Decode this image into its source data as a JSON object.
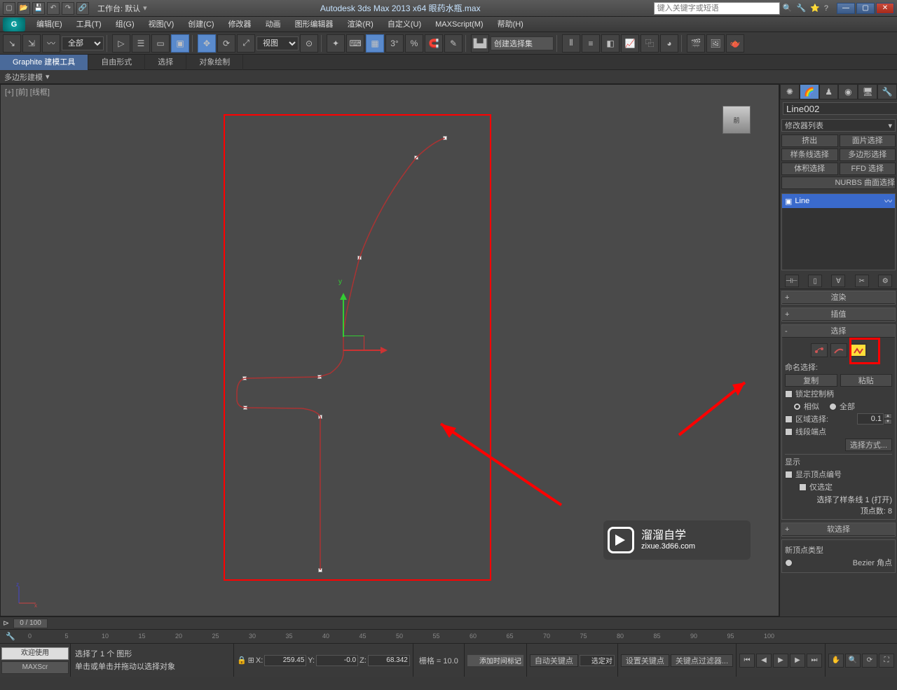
{
  "title": "Autodesk 3ds Max  2013 x64   眼药水瓶.max",
  "workspace_label": "工作台: 默认",
  "search_placeholder": "键入关键字或短语",
  "menus": [
    "编辑(E)",
    "工具(T)",
    "组(G)",
    "视图(V)",
    "创建(C)",
    "修改器",
    "动画",
    "图形编辑器",
    "渲染(R)",
    "自定义(U)",
    "MAXScript(M)",
    "帮助(H)"
  ],
  "toolbar": {
    "sel_filter": "全部",
    "ref_coord": "视图",
    "named_sel": "创建选择集"
  },
  "ribbon": {
    "tabs": [
      "Graphite 建模工具",
      "自由形式",
      "选择",
      "对象绘制"
    ],
    "sub": "多边形建模"
  },
  "viewport": {
    "label": "[+] [前] [线框]",
    "cube": "前",
    "gizmo_y": "y"
  },
  "cmd": {
    "object_name": "Line002",
    "mod_list": "修改器列表",
    "mod_buttons": [
      "挤出",
      "面片选择",
      "样条线选择",
      "多边形选择",
      "体积选择",
      "FFD 选择"
    ],
    "nurbs": "NURBS 曲面选择",
    "stack_item": "Line",
    "rollouts": {
      "render": "渲染",
      "interp": "插值",
      "selection": "选择",
      "soft": "软选择"
    },
    "sel": {
      "named_label": "命名选择:",
      "copy": "复制",
      "paste": "粘贴",
      "lock_handles": "锁定控制柄",
      "similar": "相似",
      "all": "全部",
      "area_sel": "区域选择:",
      "area_val": "0.1",
      "seg_end": "线段端点",
      "sel_mode": "选择方式...",
      "display": "显示",
      "show_vert_num": "显示顶点编号",
      "sel_only": "仅选定",
      "sel_spline_info": "选择了样条线 1 (打开)",
      "vert_count": "顶点数: 8"
    },
    "geom_btns": [
      "新顶点类型",
      "Bezier 角点"
    ]
  },
  "timeslider": "0 / 100",
  "timeline_ticks": [
    "0",
    "5",
    "10",
    "15",
    "20",
    "25",
    "30",
    "35",
    "40",
    "45",
    "50",
    "55",
    "60",
    "65",
    "70",
    "75",
    "80",
    "85",
    "90",
    "95",
    "100"
  ],
  "status": {
    "welcome": "欢迎使用",
    "maxscript": "MAXScr",
    "msg1": "选择了 1 个 图形",
    "msg2": "单击或单击并拖动以选择对象",
    "x": "259.45",
    "y": "-0.0",
    "z": "68.342",
    "grid": "栅格 = 10.0",
    "auto_key": "自动关键点",
    "set_key": "设置关键点",
    "sel_lock": "选定对",
    "add_time": "添加时间标记",
    "key_filter": "关键点过滤器..."
  },
  "watermark": {
    "line1": "溜溜自学",
    "line2": "zixue.3d66.com"
  }
}
